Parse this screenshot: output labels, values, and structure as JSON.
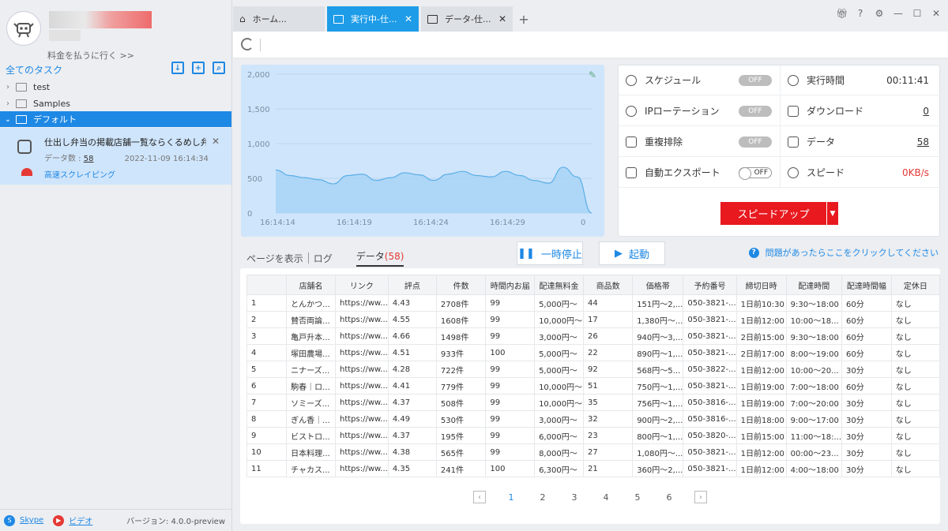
{
  "sidebar": {
    "pay_link": "料金を払うに行く >>",
    "all_tasks": "全てのタスク",
    "tree": [
      {
        "label": "test"
      },
      {
        "label": "Samples"
      },
      {
        "label": "デフォルト"
      }
    ],
    "task": {
      "title": "仕出し弁当の掲載店舗一覧ならくるめし弁...",
      "count_label": "データ数 :",
      "count": "58",
      "timestamp": "2022-11-09 16:14:34",
      "mode": "高速スクレイピング"
    },
    "footer": {
      "skype": "Skype",
      "video": "ビデオ",
      "version": "バージョン: 4.0.0-preview"
    }
  },
  "tabs": [
    {
      "label": "ホーム...",
      "icon": "home-icon"
    },
    {
      "label": "実行中-仕...",
      "icon": "window-icon"
    },
    {
      "label": "データ-仕...",
      "icon": "window-icon"
    }
  ],
  "stats": {
    "schedule": {
      "label": "スケジュール",
      "state": "OFF"
    },
    "ip": {
      "label": "IPローテーション",
      "state": "OFF"
    },
    "dedupe": {
      "label": "重複排除",
      "state": "OFF"
    },
    "export": {
      "label": "自動エクスポート",
      "state": "OFF"
    },
    "runtime": {
      "label": "実行時間",
      "value": "00:11:41"
    },
    "download": {
      "label": "ダウンロード",
      "value": "0"
    },
    "data": {
      "label": "データ",
      "value": "58"
    },
    "speed": {
      "label": "スピード",
      "value": "0KB/s"
    },
    "speedup_label": "スピードアップ"
  },
  "controls": {
    "view_page": "ページを表示",
    "log": "ログ",
    "data_tab": "データ",
    "data_count": "(58)",
    "pause": "一時停止",
    "start": "起動",
    "help": "問題があったらここをクリックしてください"
  },
  "chart_data": {
    "type": "area",
    "y_ticks": [
      "2,000",
      "1,500",
      "1,000",
      "500",
      "0"
    ],
    "x_ticks": [
      "16:14:14",
      "16:14:19",
      "16:14:24",
      "16:14:29"
    ],
    "last_value_label": "0",
    "ylim": [
      0,
      2000
    ],
    "values": [
      620,
      540,
      510,
      480,
      420,
      540,
      560,
      470,
      510,
      580,
      550,
      470,
      560,
      600,
      540,
      520,
      600,
      540,
      470,
      430,
      660,
      520,
      0
    ]
  },
  "table": {
    "headers": [
      "",
      "店舗名",
      "リンク",
      "評点",
      "件数",
      "時間内お届",
      "配達無料金",
      "商品数",
      "価格帯",
      "予約番号",
      "締切日時",
      "配達時間",
      "配達時間幅",
      "定休日"
    ],
    "rows": [
      [
        "1",
        "とんかつ...",
        "https://ww...",
        "4.43",
        "2708件",
        "99",
        "5,000円〜",
        "44",
        "151円～2,...",
        "050-3821-...",
        "1日前10:30",
        "9:30～18:00",
        "60分",
        "なし"
      ],
      [
        "2",
        "賛否両論...",
        "https://ww...",
        "4.55",
        "1608件",
        "99",
        "10,000円〜",
        "17",
        "1,380円～...",
        "050-3821-...",
        "1日前12:00",
        "10:00～18...",
        "60分",
        "なし"
      ],
      [
        "3",
        "亀戸升本...",
        "https://ww...",
        "4.66",
        "1498件",
        "99",
        "3,000円〜",
        "26",
        "940円～3,...",
        "050-3821-...",
        "2日前15:00",
        "9:30～18:00",
        "60分",
        "なし"
      ],
      [
        "4",
        "塚田農場...",
        "https://ww...",
        "4.51",
        "933件",
        "100",
        "5,000円〜",
        "22",
        "890円～1,...",
        "050-3821-...",
        "2日前17:00",
        "8:00～19:00",
        "60分",
        "なし"
      ],
      [
        "5",
        "ニナーズ...",
        "https://ww...",
        "4.28",
        "722件",
        "99",
        "5,000円〜",
        "92",
        "568円～5...",
        "050-3822-...",
        "1日前12:00",
        "10:00～20...",
        "30分",
        "なし"
      ],
      [
        "6",
        "駒春｜ロ...",
        "https://ww...",
        "4.41",
        "779件",
        "99",
        "10,000円〜",
        "51",
        "750円～1,...",
        "050-3821-...",
        "1日前19:00",
        "7:00～18:00",
        "60分",
        "なし"
      ],
      [
        "7",
        "ソミーズ...",
        "https://ww...",
        "4.37",
        "508件",
        "99",
        "10,000円〜",
        "35",
        "756円～1,...",
        "050-3816-...",
        "1日前19:00",
        "7:00～20:00",
        "30分",
        "なし"
      ],
      [
        "8",
        "ぎん香｜...",
        "https://ww...",
        "4.49",
        "530件",
        "99",
        "3,000円〜",
        "32",
        "900円～2,...",
        "050-3816-...",
        "1日前18:00",
        "9:00～17:00",
        "30分",
        "なし"
      ],
      [
        "9",
        "ビストロ...",
        "https://ww...",
        "4.37",
        "195件",
        "99",
        "6,000円〜",
        "23",
        "800円～1,...",
        "050-3820-...",
        "1日前15:00",
        "11:00～18:...",
        "30分",
        "なし"
      ],
      [
        "10",
        "日本料理...",
        "https://ww...",
        "4.38",
        "565件",
        "99",
        "8,000円〜",
        "27",
        "1,080円～...",
        "050-3821-...",
        "1日前12:00",
        "00:00～23...",
        "30分",
        "なし"
      ],
      [
        "11",
        "チャカス...",
        "https://ww...",
        "4.35",
        "241件",
        "100",
        "6,300円〜",
        "21",
        "360円～2,...",
        "050-3821-...",
        "1日前12:00",
        "4:00～18:00",
        "30分",
        "なし"
      ]
    ]
  },
  "pager": {
    "pages": [
      "1",
      "2",
      "3",
      "4",
      "5",
      "6"
    ],
    "current": "1"
  },
  "colors": {
    "accent": "#1e88e5",
    "tab_active": "#1e9ce8",
    "speedup": "#e8191f",
    "chart_fill": "#a8d4f5"
  }
}
